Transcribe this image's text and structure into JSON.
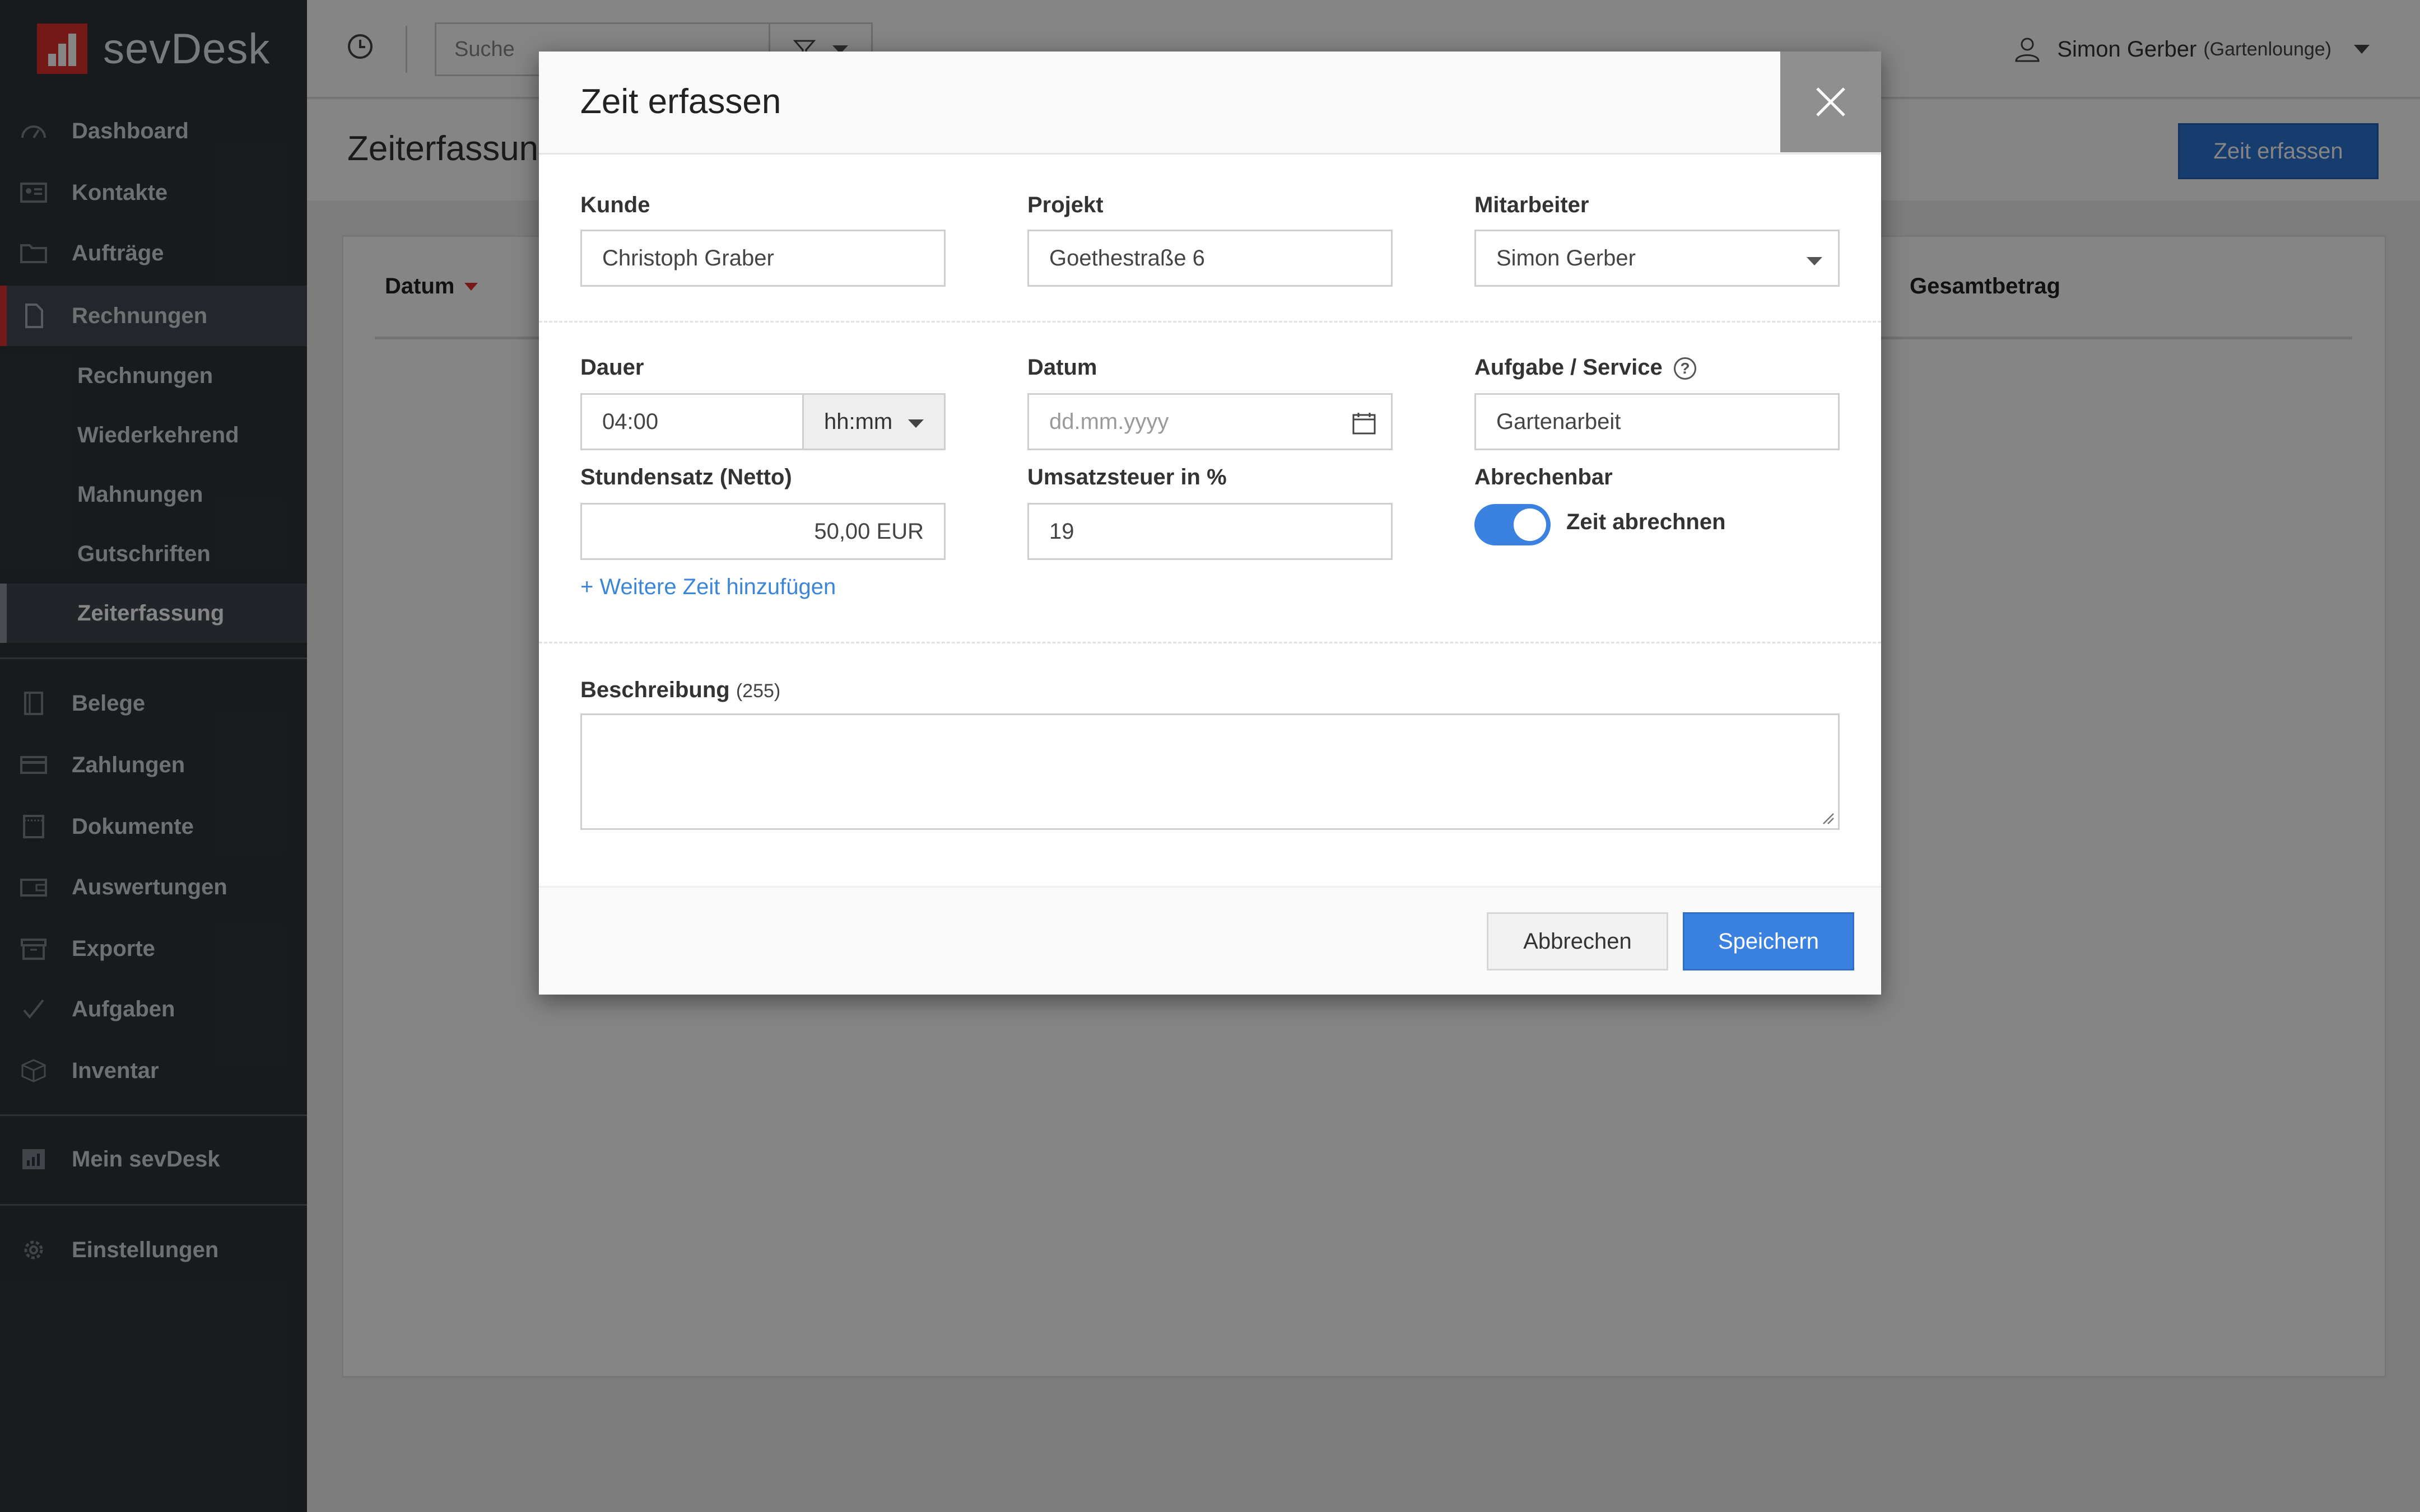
{
  "app": {
    "brand": "sevDesk"
  },
  "sidebar": {
    "items": [
      {
        "label": "Dashboard",
        "icon": "dashboard-icon"
      },
      {
        "label": "Kontakte",
        "icon": "contacts-icon"
      },
      {
        "label": "Aufträge",
        "icon": "folder-icon"
      },
      {
        "label": "Rechnungen",
        "icon": "document-icon"
      }
    ],
    "sub_items": [
      {
        "label": "Rechnungen"
      },
      {
        "label": "Wiederkehrend"
      },
      {
        "label": "Mahnungen"
      },
      {
        "label": "Gutschriften"
      },
      {
        "label": "Zeiterfassung"
      }
    ],
    "items2": [
      {
        "label": "Belege",
        "icon": "receipt-icon"
      },
      {
        "label": "Zahlungen",
        "icon": "credit-card-icon"
      },
      {
        "label": "Dokumente",
        "icon": "documents-icon"
      },
      {
        "label": "Auswertungen",
        "icon": "wallet-icon"
      },
      {
        "label": "Exporte",
        "icon": "archive-icon"
      },
      {
        "label": "Aufgaben",
        "icon": "checkmark-icon"
      },
      {
        "label": "Inventar",
        "icon": "box-icon"
      }
    ],
    "mein": {
      "label": "Mein sevDesk",
      "icon": "bar-chart-icon"
    },
    "settings": {
      "label": "Einstellungen",
      "icon": "gear-icon"
    }
  },
  "header": {
    "search_placeholder": "Suche",
    "user_name": "Simon Gerber",
    "user_org": "(Gartenlounge)"
  },
  "page": {
    "title": "Zeiterfassung",
    "primary_button": "Zeit erfassen",
    "table": {
      "col_datum": "Datum",
      "col_total": "Gesamtbetrag"
    }
  },
  "modal": {
    "title": "Zeit erfassen",
    "kunde": {
      "label": "Kunde",
      "value": "Christoph Graber"
    },
    "projekt": {
      "label": "Projekt",
      "value": "Goethestraße 6"
    },
    "mitarbeiter": {
      "label": "Mitarbeiter",
      "value": "Simon Gerber"
    },
    "dauer": {
      "label": "Dauer",
      "value": "04:00",
      "unit": "hh:mm"
    },
    "datum": {
      "label": "Datum",
      "placeholder": "dd.mm.yyyy"
    },
    "aufgabe": {
      "label": "Aufgabe / Service",
      "value": "Gartenarbeit"
    },
    "stundensatz": {
      "label": "Stundensatz (Netto)",
      "value": "50,00 EUR"
    },
    "ust": {
      "label": "Umsatzsteuer in %",
      "value": "19"
    },
    "abrechenbar": {
      "label": "Abrechenbar",
      "toggle_label": "Zeit abrechnen",
      "enabled": true
    },
    "add_more": "+ Weitere Zeit hinzufügen",
    "beschreibung": {
      "label": "Beschreibung",
      "count": "(255)",
      "value": ""
    },
    "cancel": "Abbrechen",
    "save": "Speichern"
  },
  "colors": {
    "accent": "#e0312f",
    "primary": "#3b82e0",
    "sidebar_bg": "#2f343b"
  }
}
